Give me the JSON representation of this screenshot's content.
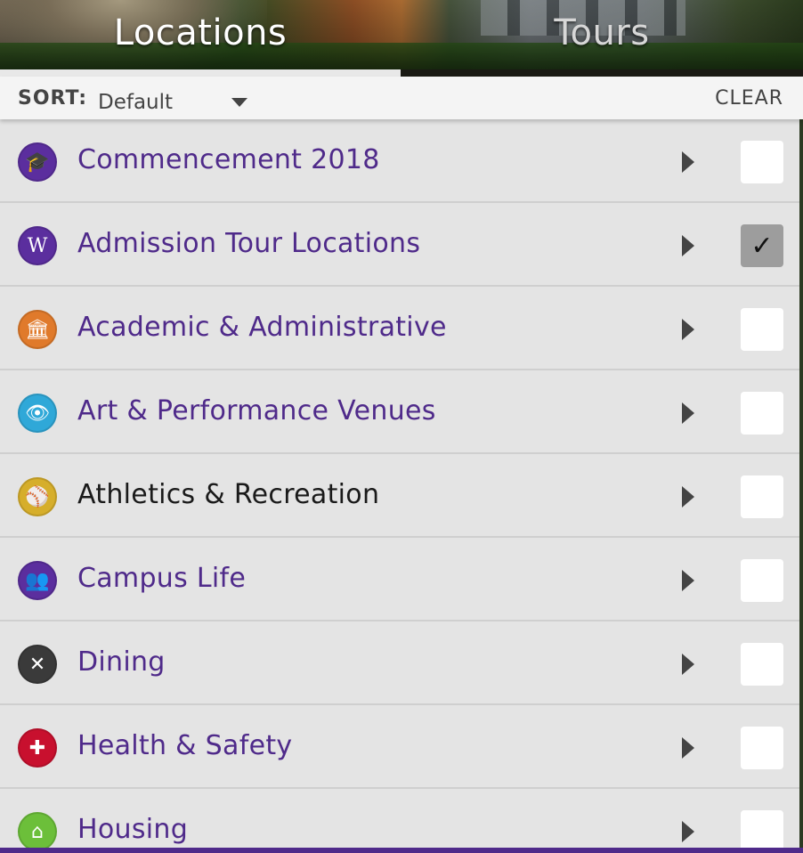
{
  "tabs": [
    {
      "label": "Locations",
      "active": true
    },
    {
      "label": "Tours",
      "active": false
    }
  ],
  "sort": {
    "label": "SORT:",
    "selected": "Default",
    "clear_label": "CLEAR"
  },
  "categories": [
    {
      "label": "Commencement 2018",
      "icon": "graduation-cap-icon",
      "icon_glyph": "🎓",
      "icon_color": "#5b2e9e",
      "checked": false,
      "check_glyph": ""
    },
    {
      "label": "Admission Tour Locations",
      "icon": "w-logo-icon",
      "icon_glyph": "W",
      "icon_color": "#5b2e9e",
      "checked": true,
      "check_glyph": "✓"
    },
    {
      "label": "Academic & Administrative",
      "icon": "building-columns-icon",
      "icon_glyph": "🏛",
      "icon_color": "#e07a2b",
      "checked": false,
      "check_glyph": ""
    },
    {
      "label": "Art & Performance Venues",
      "icon": "eye-icon",
      "icon_glyph": "👁",
      "icon_color": "#2fa8d8",
      "checked": false,
      "check_glyph": ""
    },
    {
      "label": "Athletics & Recreation",
      "icon": "ball-icon",
      "icon_glyph": "⚾",
      "icon_color": "#d6ae2b",
      "checked": false,
      "check_glyph": ""
    },
    {
      "label": "Campus Life",
      "icon": "people-icon",
      "icon_glyph": "👥",
      "icon_color": "#5b2e9e",
      "checked": false,
      "check_glyph": ""
    },
    {
      "label": "Dining",
      "icon": "fork-knife-icon",
      "icon_glyph": "✕",
      "icon_color": "#3a3a3a",
      "checked": false,
      "check_glyph": ""
    },
    {
      "label": "Health & Safety",
      "icon": "medical-cross-icon",
      "icon_glyph": "✚",
      "icon_color": "#c8102e",
      "checked": false,
      "check_glyph": ""
    },
    {
      "label": "Housing",
      "icon": "house-icon",
      "icon_glyph": "⌂",
      "icon_color": "#6cbf3a",
      "checked": false,
      "check_glyph": ""
    }
  ]
}
